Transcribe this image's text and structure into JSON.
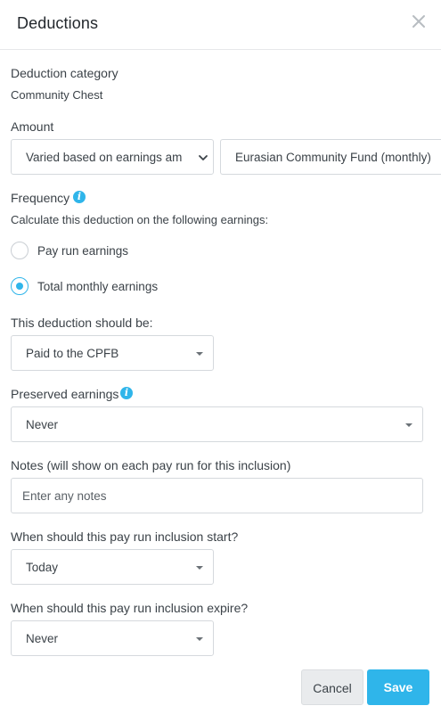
{
  "dialog": {
    "title": "Deductions",
    "close_icon": "close-icon"
  },
  "deduction_category": {
    "label": "Deduction category",
    "value": "Community Chest"
  },
  "amount": {
    "label": "Amount",
    "type_value": "Varied based on earnings am",
    "fund_value": "Eurasian Community Fund (monthly)"
  },
  "frequency": {
    "label": "Frequency",
    "description": "Calculate this deduction on the following earnings:",
    "options": [
      {
        "label": "Pay run earnings",
        "selected": false
      },
      {
        "label": "Total monthly earnings",
        "selected": true
      }
    ],
    "info_icon": "info-icon"
  },
  "deduction_should_be": {
    "label": "This deduction should be:",
    "value": "Paid to the CPFB"
  },
  "preserved_earnings": {
    "label": "Preserved earnings",
    "value": "Never",
    "info_icon": "info-icon"
  },
  "notes": {
    "label": "Notes (will show on each pay run for this inclusion)",
    "placeholder": "Enter any notes"
  },
  "start": {
    "label": "When should this pay run inclusion start?",
    "value": "Today"
  },
  "expire": {
    "label": "When should this pay run inclusion expire?",
    "value": "Never"
  },
  "buttons": {
    "cancel": "Cancel",
    "save": "Save"
  },
  "colors": {
    "accent": "#2fb5ea",
    "border": "#d5d9dd",
    "text": "#3b4248"
  }
}
